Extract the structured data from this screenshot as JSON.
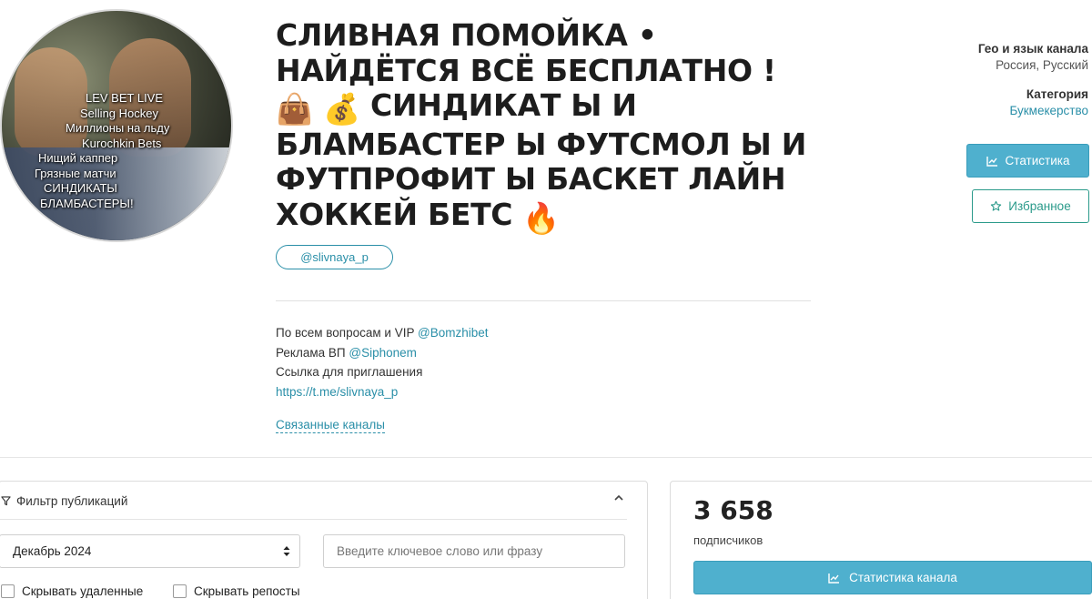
{
  "avatar": {
    "caption_lines": [
      "LEV BET LIVE",
      "Selling Hockey",
      "Миллионы на льду",
      "Kurochkin Bets",
      "Нищий каппер",
      "Грязные матчи",
      "СИНДИКАТЫ",
      "БЛАМБАСТЕРЫ!"
    ]
  },
  "channel": {
    "title_line1": "СЛИВНАЯ ПОМОЙКА •",
    "title_line2": "НАЙДЁТСЯ ВСЁ БЕСПЛАТНО !",
    "title_line3_emoji1": "👜",
    "title_line3_emoji2": "💰",
    "title_line3_text": "СИНДИКАТ Ы И",
    "title_line4": "БЛАМБАСТЕР Ы ФУТСМОЛ Ы И",
    "title_line5": "ФУТПРОФИТ Ы БАСКЕТ ЛАЙН",
    "title_line6_text": "ХОККЕЙ БЕТС",
    "title_line6_emoji": "🔥",
    "handle": "@slivnaya_p"
  },
  "description": {
    "line1_text": "По всем вопросам и VIP ",
    "line1_link": "@Bomzhibet",
    "line2_text": "Реклама ВП ",
    "line2_link": "@Siphonem",
    "line3_text": "Ссылка для приглашения",
    "line4_link": "https://t.me/slivnaya_p",
    "related_label": "Связанные каналы"
  },
  "sidebar": {
    "geo_header": "Гео и язык канала",
    "geo_value": "Россия, Русский",
    "category_header": "Категория",
    "category_value": "Букмекерство",
    "stats_button": "Статистика",
    "favorites_button": "Избранное"
  },
  "filter": {
    "header": "Фильтр публикаций",
    "month_value": "Декабрь 2024",
    "search_placeholder": "Введите ключевое слово или фразу",
    "hide_deleted": "Скрывать удаленные",
    "hide_reposts": "Скрывать репосты"
  },
  "stats": {
    "subscribers_count": "3 658",
    "subscribers_label": "подписчиков",
    "channel_stats_button": "Статистика канала"
  },
  "colors": {
    "accent": "#4fb0ce",
    "link": "#2a8fa8",
    "favorite": "#2a9a8a"
  }
}
